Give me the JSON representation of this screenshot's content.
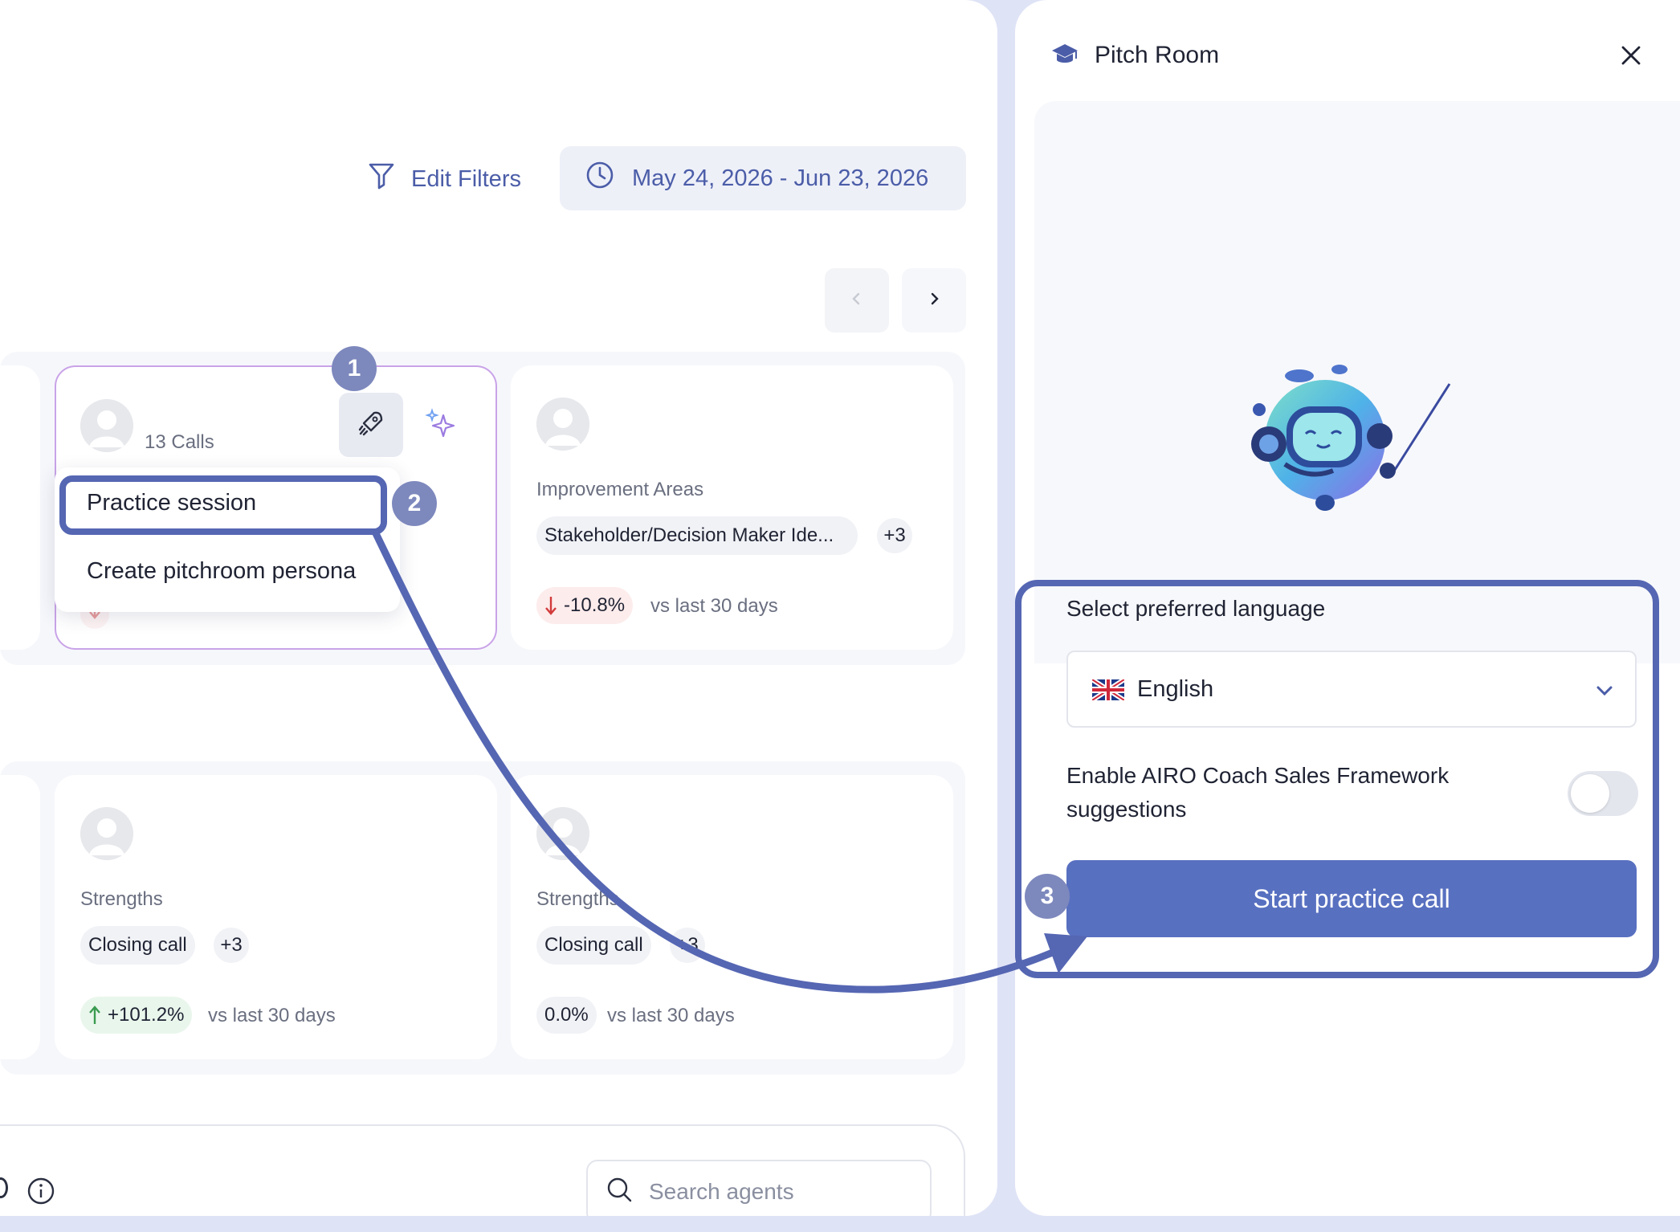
{
  "filters": {
    "edit_filters_label": "Edit Filters",
    "date_range": "May 24, 2026 - Jun 23, 2026"
  },
  "cards": {
    "card1": {
      "calls": "13 Calls"
    },
    "card2": {
      "section_label": "Improvement Areas",
      "chip": "Stakeholder/Decision Maker Ide...",
      "more": "+3",
      "delta": "-10.8%",
      "delta_direction": "down",
      "vs": "vs last 30 days"
    },
    "card3": {
      "section_label": "Strengths",
      "chip": "Closing call",
      "more": "+3",
      "delta": "+101.2%",
      "delta_direction": "up",
      "vs": "vs last 30 days"
    },
    "card4": {
      "section_label": "Strengths",
      "chip": "Closing call",
      "more": "+3",
      "delta": "0.0%",
      "delta_direction": "neutral",
      "vs": "vs last 30 days"
    }
  },
  "context_menu": {
    "items": [
      "Practice session",
      "Create pitchroom persona"
    ]
  },
  "steps": [
    "1",
    "2",
    "3"
  ],
  "bottom": {
    "search_placeholder": "Search agents"
  },
  "pitch_room": {
    "title": "Pitch Room",
    "language_label": "Select preferred language",
    "language_value": "English",
    "framework_label_line1": "Enable AIRO Coach Sales Framework",
    "framework_label_line2": "suggestions",
    "framework_enabled": false,
    "start_button": "Start practice call"
  },
  "colors": {
    "accent": "#5870c0",
    "link": "#4b5da8",
    "annotation": "#5566b3",
    "badge": "#7d88bd",
    "negative": "#d23b3b",
    "positive": "#3a9b50"
  }
}
